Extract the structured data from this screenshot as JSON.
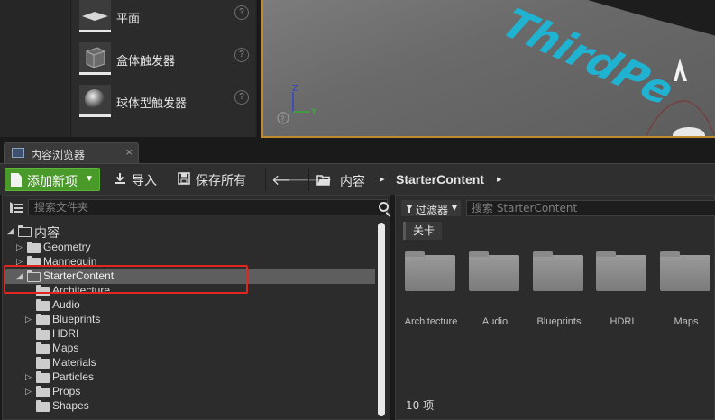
{
  "place_panel": {
    "items": [
      {
        "label": "平面",
        "thumb_icon": "plane-icon"
      },
      {
        "label": "盒体触发器",
        "thumb_icon": "box-trigger-icon"
      },
      {
        "label": "球体型触发器",
        "thumb_icon": "sphere-trigger-icon"
      }
    ],
    "help_glyph": "?"
  },
  "viewport": {
    "floor_text": "ThirdPe",
    "axis_z": "Z",
    "axis_y": "Y",
    "help_glyph": "?",
    "accent_color": "#c08a2e",
    "text_color": "#1fb3d1"
  },
  "tab": {
    "label": "内容浏览器",
    "close_glyph": "×"
  },
  "toolbar": {
    "add_new_label": "添加新项",
    "import_label": "导入",
    "save_all_label": "保存所有",
    "add_new_color": "#4a9a2a"
  },
  "path": {
    "crumbs": [
      "内容",
      "StarterContent"
    ],
    "separator": "▸"
  },
  "tree": {
    "search_placeholder": "搜索文件夹",
    "items": [
      {
        "label": "内容",
        "depth": 0,
        "expanded": true
      },
      {
        "label": "Geometry",
        "depth": 1,
        "expanded": false
      },
      {
        "label": "Mannequin",
        "depth": 1,
        "expanded": false
      },
      {
        "label": "StarterContent",
        "depth": 1,
        "expanded": true,
        "selected": true
      },
      {
        "label": "Architecture",
        "depth": 2
      },
      {
        "label": "Audio",
        "depth": 2
      },
      {
        "label": "Blueprints",
        "depth": 2,
        "expanded": false
      },
      {
        "label": "HDRI",
        "depth": 2
      },
      {
        "label": "Maps",
        "depth": 2
      },
      {
        "label": "Materials",
        "depth": 2
      },
      {
        "label": "Particles",
        "depth": 2,
        "expanded": false
      },
      {
        "label": "Props",
        "depth": 2,
        "expanded": false
      },
      {
        "label": "Shapes",
        "depth": 2
      }
    ],
    "highlight_color": "#e0261e"
  },
  "assets": {
    "filter_label": "过滤器",
    "search_placeholder": "搜索 StarterContent",
    "level_chip": "关卡",
    "folders": [
      "Architecture",
      "Audio",
      "Blueprints",
      "HDRI",
      "Maps"
    ],
    "count_label": "10 项"
  }
}
